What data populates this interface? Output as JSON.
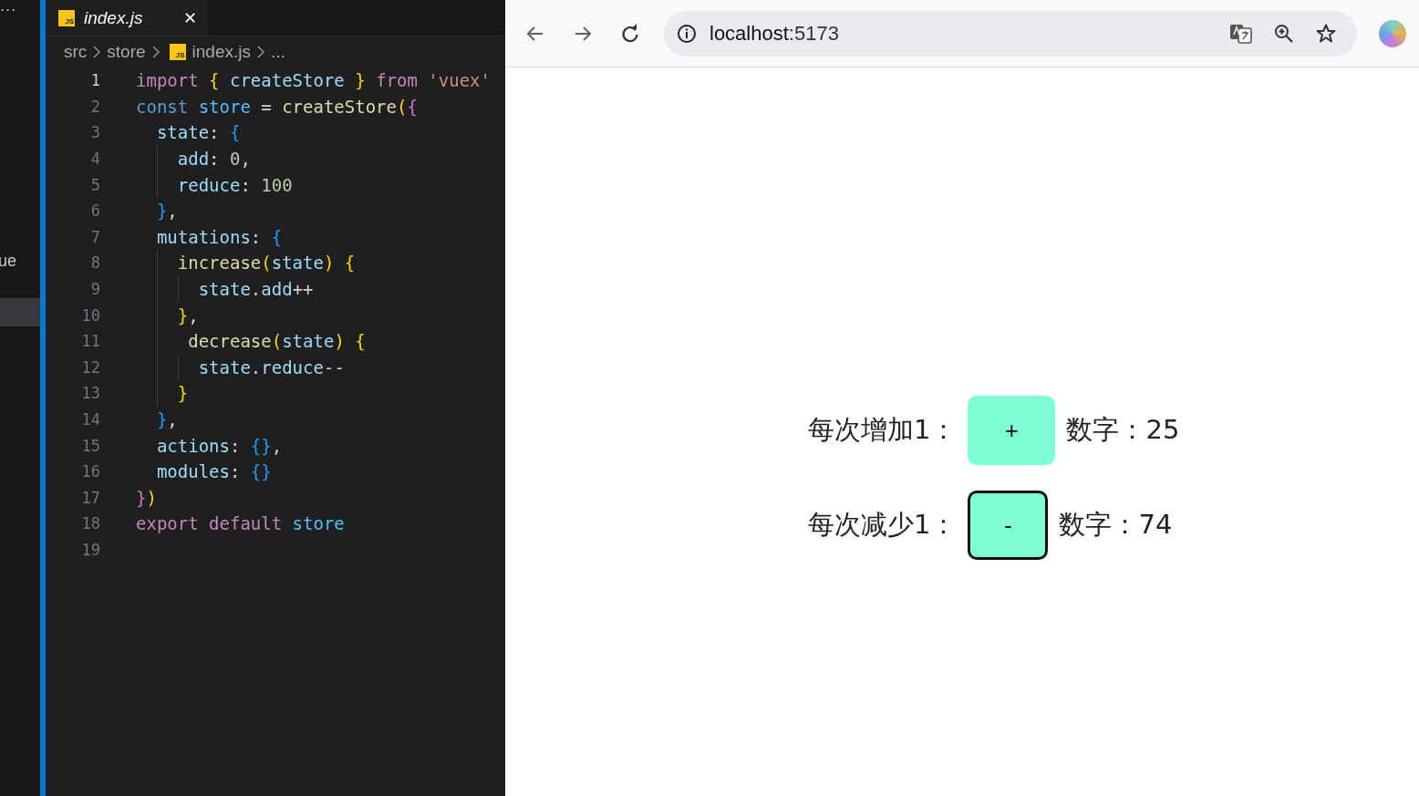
{
  "activity_bar": {
    "more": "···",
    "item_text": "ue"
  },
  "editor": {
    "tab": {
      "icon": "JS",
      "title": "index.js",
      "close": "✕"
    },
    "breadcrumbs": [
      {
        "text": "src"
      },
      {
        "text": "store"
      },
      {
        "text": "index.js",
        "icon": "JS"
      },
      {
        "text": "..."
      }
    ],
    "lines": [
      {
        "number": "1",
        "current": true,
        "tokens": [
          {
            "text": "import",
            "kind": "keyword"
          },
          {
            "text": " {",
            "kind": "brace1"
          },
          {
            "text": " createStore ",
            "kind": "property"
          },
          {
            "text": "}",
            "kind": "brace1"
          },
          {
            "text": " from",
            "kind": "keyword"
          },
          {
            "text": " 'vuex'",
            "kind": "string"
          }
        ]
      },
      {
        "number": "2",
        "current": false,
        "tokens": [
          {
            "text": "const",
            "kind": "storage"
          },
          {
            "text": " store",
            "kind": "constant"
          },
          {
            "text": " = ",
            "kind": "plain"
          },
          {
            "text": "createStore",
            "kind": "function"
          },
          {
            "text": "(",
            "kind": "brace1"
          },
          {
            "text": "{",
            "kind": "brace2"
          }
        ]
      },
      {
        "number": "3",
        "current": false,
        "tokens": [
          {
            "text": "  state",
            "kind": "property"
          },
          {
            "text": ": ",
            "kind": "plain"
          },
          {
            "text": "{",
            "kind": "brace3"
          }
        ]
      },
      {
        "number": "4",
        "current": false,
        "tokens": [
          {
            "text": "    add",
            "kind": "property"
          },
          {
            "text": ": ",
            "kind": "plain"
          },
          {
            "text": "0",
            "kind": "number"
          },
          {
            "text": ",",
            "kind": "plain"
          }
        ]
      },
      {
        "number": "5",
        "current": false,
        "tokens": [
          {
            "text": "    reduce",
            "kind": "property"
          },
          {
            "text": ": ",
            "kind": "plain"
          },
          {
            "text": "100",
            "kind": "number"
          }
        ]
      },
      {
        "number": "6",
        "current": false,
        "tokens": [
          {
            "text": "  }",
            "kind": "brace3"
          },
          {
            "text": ",",
            "kind": "plain"
          }
        ]
      },
      {
        "number": "7",
        "current": false,
        "tokens": [
          {
            "text": "  mutations",
            "kind": "property"
          },
          {
            "text": ": ",
            "kind": "plain"
          },
          {
            "text": "{",
            "kind": "brace3"
          }
        ]
      },
      {
        "number": "8",
        "current": false,
        "tokens": [
          {
            "text": "    increase",
            "kind": "function"
          },
          {
            "text": "(",
            "kind": "brace1"
          },
          {
            "text": "state",
            "kind": "property"
          },
          {
            "text": ")",
            "kind": "brace1"
          },
          {
            "text": " {",
            "kind": "brace1"
          }
        ]
      },
      {
        "number": "9",
        "current": false,
        "tokens": [
          {
            "text": "      state",
            "kind": "property"
          },
          {
            "text": ".",
            "kind": "plain"
          },
          {
            "text": "add",
            "kind": "property"
          },
          {
            "text": "++",
            "kind": "plain"
          }
        ]
      },
      {
        "number": "10",
        "current": false,
        "tokens": [
          {
            "text": "    }",
            "kind": "brace1"
          },
          {
            "text": ",",
            "kind": "plain"
          }
        ]
      },
      {
        "number": "11",
        "current": false,
        "tokens": [
          {
            "text": "     decrease",
            "kind": "function"
          },
          {
            "text": "(",
            "kind": "brace1"
          },
          {
            "text": "state",
            "kind": "property"
          },
          {
            "text": ")",
            "kind": "brace1"
          },
          {
            "text": " {",
            "kind": "brace1"
          }
        ]
      },
      {
        "number": "12",
        "current": false,
        "tokens": [
          {
            "text": "      state",
            "kind": "property"
          },
          {
            "text": ".",
            "kind": "plain"
          },
          {
            "text": "reduce",
            "kind": "property"
          },
          {
            "text": "--",
            "kind": "plain"
          }
        ]
      },
      {
        "number": "13",
        "current": false,
        "tokens": [
          {
            "text": "    }",
            "kind": "brace1"
          }
        ]
      },
      {
        "number": "14",
        "current": false,
        "tokens": [
          {
            "text": "  }",
            "kind": "brace3"
          },
          {
            "text": ",",
            "kind": "plain"
          }
        ]
      },
      {
        "number": "15",
        "current": false,
        "tokens": [
          {
            "text": "  actions",
            "kind": "property"
          },
          {
            "text": ": ",
            "kind": "plain"
          },
          {
            "text": "{}",
            "kind": "brace3"
          },
          {
            "text": ",",
            "kind": "plain"
          }
        ]
      },
      {
        "number": "16",
        "current": false,
        "tokens": [
          {
            "text": "  modules",
            "kind": "property"
          },
          {
            "text": ": ",
            "kind": "plain"
          },
          {
            "text": "{}",
            "kind": "brace3"
          }
        ]
      },
      {
        "number": "17",
        "current": false,
        "tokens": [
          {
            "text": "}",
            "kind": "brace2"
          },
          {
            "text": ")",
            "kind": "brace1"
          }
        ]
      },
      {
        "number": "18",
        "current": false,
        "tokens": [
          {
            "text": "export",
            "kind": "keyword"
          },
          {
            "text": " default",
            "kind": "keyword"
          },
          {
            "text": " store",
            "kind": "constant"
          }
        ]
      },
      {
        "number": "19",
        "current": false
      }
    ]
  },
  "browser": {
    "address": {
      "host": "localhost",
      "port": ":5173"
    },
    "counters": [
      {
        "label": "每次增加1：",
        "button": "+",
        "focused": false,
        "reading": "数字：25"
      },
      {
        "label": "每次减少1：",
        "button": "-",
        "focused": true,
        "reading": "数字：74"
      }
    ]
  }
}
